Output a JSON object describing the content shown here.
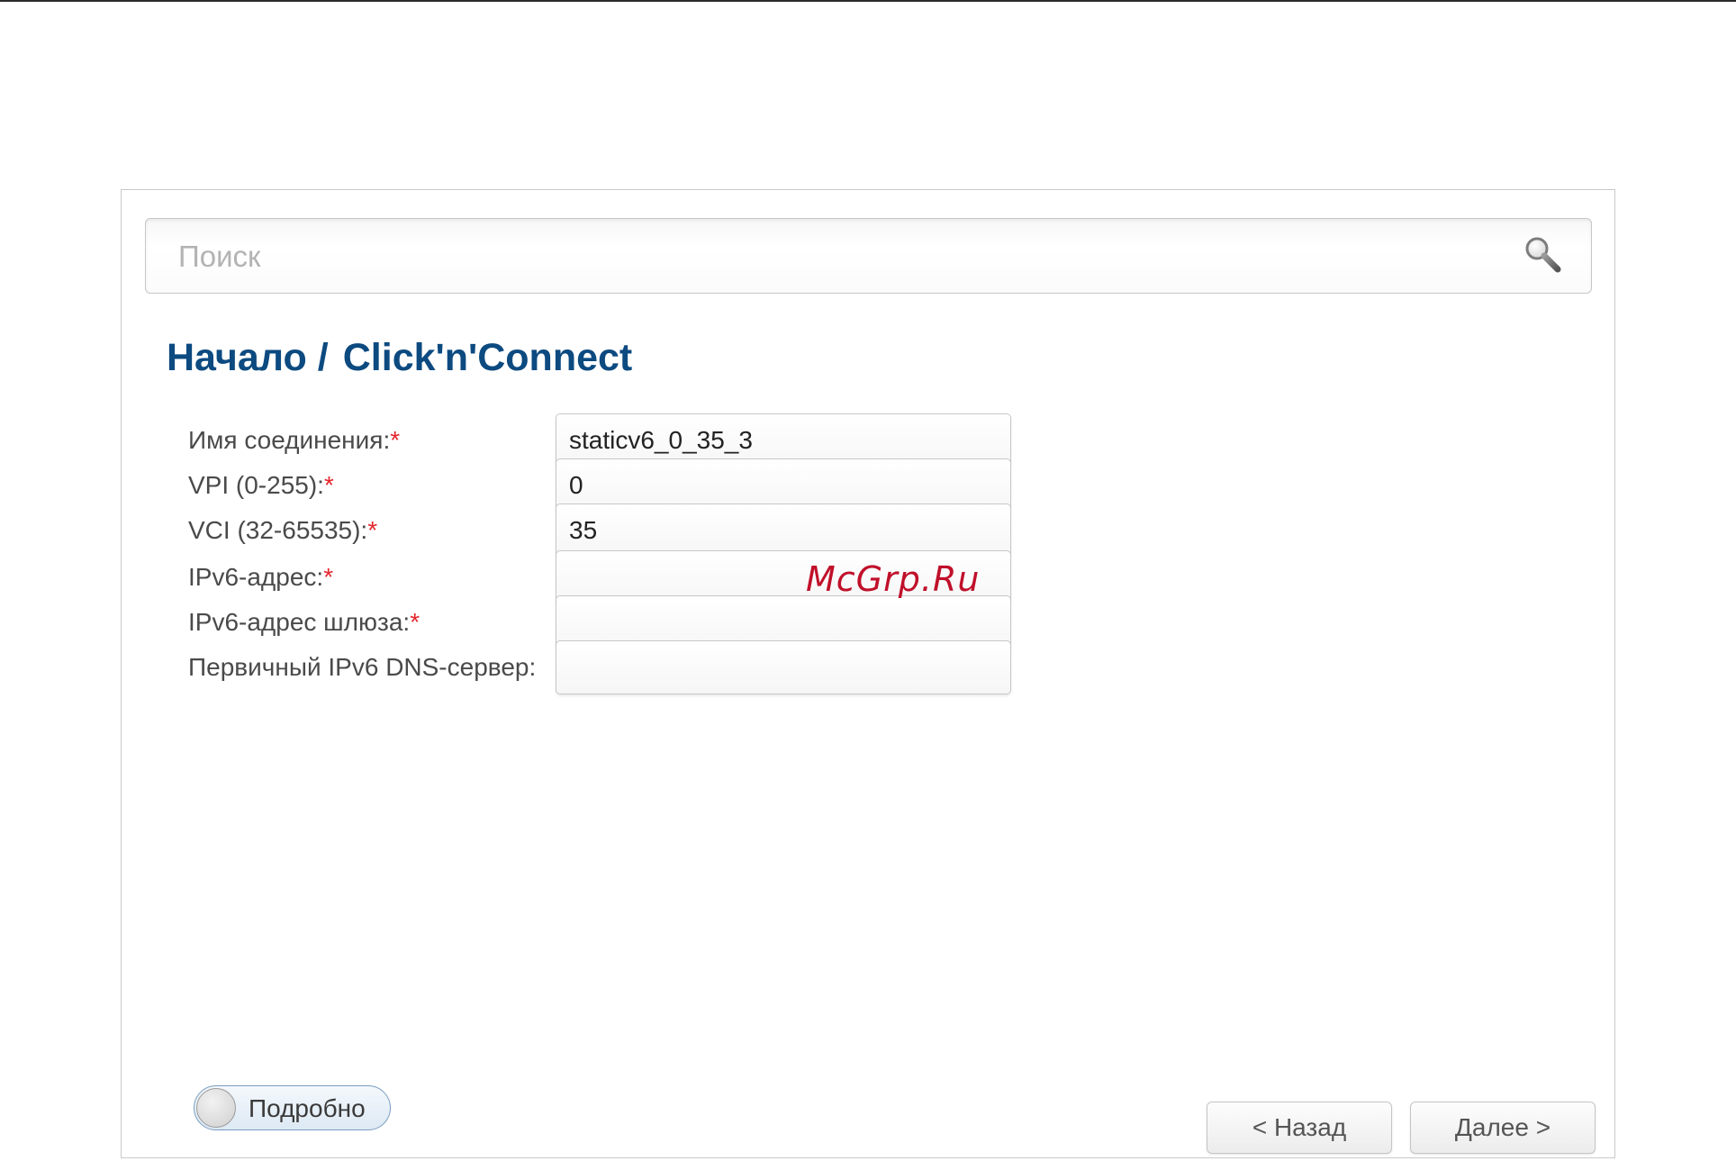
{
  "search": {
    "placeholder": "Поиск",
    "icon": "search-icon"
  },
  "breadcrumb": {
    "home": "Начало",
    "separator": "/",
    "current": "Click'n'Connect"
  },
  "form": {
    "required_marker": "*",
    "fields": [
      {
        "label": "Имя соединения:",
        "required": true,
        "value": "staticv6_0_35_3"
      },
      {
        "label": "VPI (0-255):",
        "required": true,
        "value": "0"
      },
      {
        "label": "VCI (32-65535):",
        "required": true,
        "value": "35"
      },
      {
        "label": "IPv6-адрес:",
        "required": true,
        "value": ""
      },
      {
        "label": "IPv6-адрес шлюза:",
        "required": true,
        "value": ""
      },
      {
        "label": "Первичный IPv6 DNS-сервер:",
        "required": false,
        "value": ""
      }
    ]
  },
  "watermark": "McGrp.Ru",
  "details_toggle": {
    "label": "Подробно",
    "on": false
  },
  "buttons": {
    "back": "< Назад",
    "next": "Далее >"
  },
  "colors": {
    "title": "#0c4a80",
    "required": "#e4262c",
    "watermark": "#c0102a"
  }
}
